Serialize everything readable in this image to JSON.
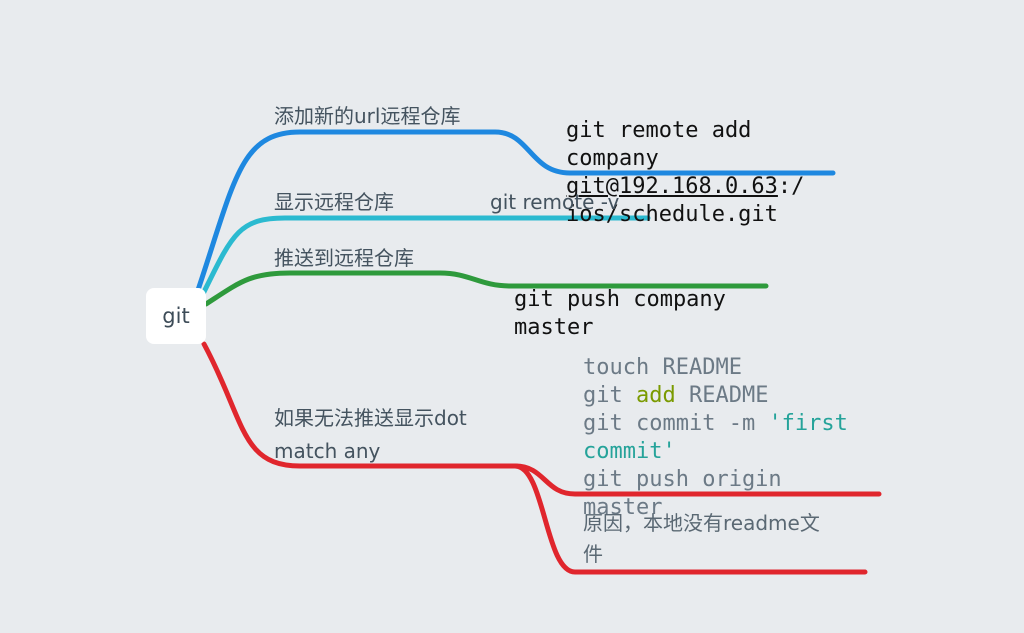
{
  "root": {
    "label": "git"
  },
  "branches": [
    {
      "label": "添加新的url远程仓库",
      "color": "#1e88e0",
      "detail_lines": [
        "git remote add",
        "company",
        "git@192.168.0.63:/",
        "ios/schedule.git"
      ],
      "detail_link": "git@192.168.0.63"
    },
    {
      "label": "显示远程仓库",
      "color": "#2bbad0",
      "detail": "git remote -v"
    },
    {
      "label": "推送到远程仓库",
      "color": "#2e9a3c",
      "detail_lines": [
        "git push company",
        "master"
      ]
    },
    {
      "label_lines": [
        "如果无法推送显示dot",
        "match any"
      ],
      "color": "#e0262d",
      "code": {
        "line1": "touch README",
        "line2_cmd": "git ",
        "line2_kw": "add",
        "line2_rest": " README",
        "line3_cmd": "git commit -m ",
        "line3_str": "'first",
        "line4_str": "commit'",
        "line5": "git push origin",
        "line6": "master"
      },
      "note_lines": [
        "原因，本地没有readme文",
        "件"
      ]
    }
  ]
}
